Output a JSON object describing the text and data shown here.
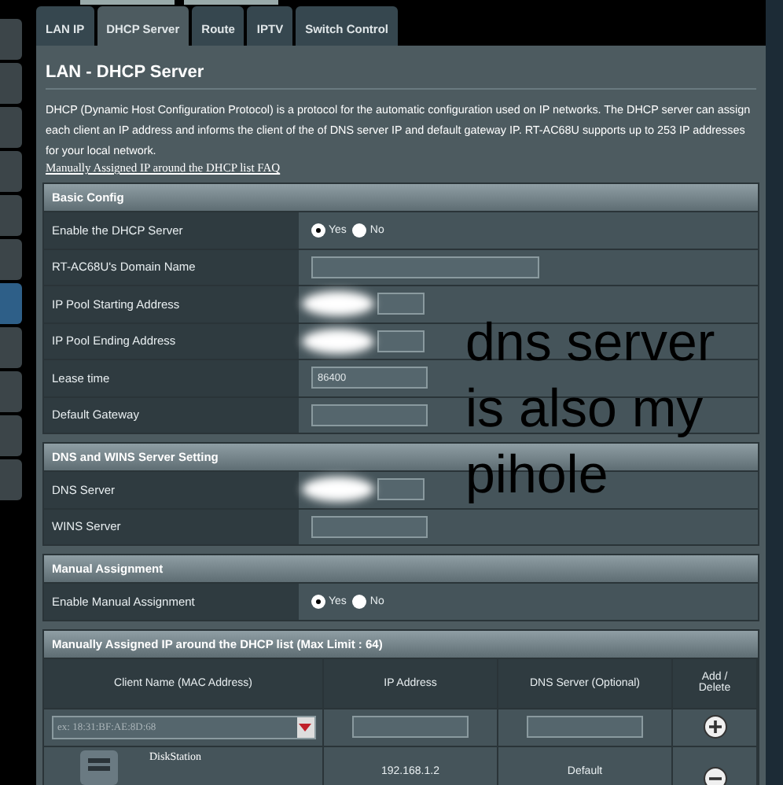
{
  "sidebar": [
    {
      "selected": false
    },
    {
      "selected": false
    },
    {
      "selected": false
    },
    {
      "selected": false
    },
    {
      "selected": false
    },
    {
      "selected": false
    },
    {
      "selected": true
    },
    {
      "selected": false
    },
    {
      "selected": false
    },
    {
      "selected": false
    },
    {
      "selected": false
    }
  ],
  "tabs": [
    {
      "label": "LAN IP",
      "selected": false
    },
    {
      "label": "DHCP Server",
      "selected": true
    },
    {
      "label": "Route",
      "selected": false
    },
    {
      "label": "IPTV",
      "selected": false
    },
    {
      "label": "Switch Control",
      "selected": false
    }
  ],
  "title": "LAN - DHCP Server",
  "description": "DHCP (Dynamic Host Configuration Protocol) is a protocol for the automatic configuration used on IP networks. The DHCP server can assign each client an IP address and informs the client of the of DNS server IP and default gateway IP. RT-AC68U supports up to 253 IP addresses for your local network.",
  "faq_link": "Manually Assigned IP around the DHCP list FAQ",
  "sections": [
    {
      "title": "Basic Config",
      "rows": [
        {
          "kind": "radio",
          "label": "Enable the DHCP Server",
          "options": [
            {
              "label": "Yes",
              "selected": true
            },
            {
              "label": "No",
              "selected": false
            }
          ]
        },
        {
          "kind": "wide",
          "label": "RT-AC68U's Domain Name"
        },
        {
          "kind": "field",
          "label": "IP Pool Starting Address",
          "redacted": true
        },
        {
          "kind": "field",
          "label": "IP Pool Ending Address",
          "redacted": true
        },
        {
          "kind": "field",
          "label": "Lease time",
          "value": "86400"
        },
        {
          "kind": "field",
          "label": "Default Gateway"
        }
      ]
    },
    {
      "title": "DNS and WINS Server Setting",
      "rows": [
        {
          "kind": "field",
          "label": "DNS Server",
          "redacted": true
        },
        {
          "kind": "field",
          "label": "WINS Server"
        }
      ]
    },
    {
      "title": "Manual Assignment",
      "rows": [
        {
          "kind": "radio",
          "label": "Enable Manual Assignment",
          "options": [
            {
              "label": "Yes",
              "selected": true
            },
            {
              "label": "No",
              "selected": false
            }
          ]
        }
      ]
    }
  ],
  "list": {
    "title": "Manually Assigned IP around the DHCP list (Max Limit : 64)",
    "columns": [
      "Client Name (MAC Address)",
      "IP Address",
      "DNS Server (Optional)",
      "Add / Delete"
    ],
    "mac_placeholder": "ex: 18:31:BF:AE:8D:68",
    "rows": [
      {
        "name": "DiskStation",
        "ip": "192.168.1.2",
        "dns": "Default"
      }
    ]
  },
  "annotation": "dns server is also my pihole"
}
